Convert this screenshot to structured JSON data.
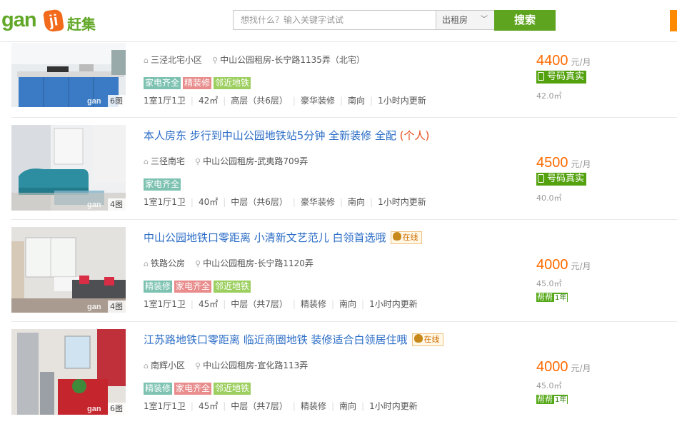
{
  "header": {
    "logo_text": "gan",
    "logo_badge": "ji",
    "logo_cn": "赶集",
    "search_placeholder": "想找什么？输入关键字试试",
    "category": "出租房",
    "search_button": "搜索"
  },
  "listings": [
    {
      "title": "",
      "personal": "",
      "online": "",
      "community": "三泾北宅小区",
      "location": "中山公园租房-长宁路1135弄（北宅）",
      "tags": [
        "家电齐全",
        "精装修",
        "邻近地铁"
      ],
      "meta": [
        "1室1厅1卫",
        "42㎡",
        "高层（共6层）",
        "豪华装修",
        "南向",
        "1小时内更新"
      ],
      "price": "4400",
      "price_unit": "元/月",
      "verify": "号码真实",
      "area": "42.0㎡",
      "bangbang": "",
      "photo_count": "6图"
    },
    {
      "title": "本人房东 步行到中山公园地铁站5分钟 全新装修 全配",
      "personal": "(个人)",
      "online": "",
      "community": "三径南宅",
      "location": "中山公园租房-武夷路709弄",
      "tags": [
        "家电齐全"
      ],
      "meta": [
        "1室1厅1卫",
        "40㎡",
        "中层（共6层）",
        "豪华装修",
        "南向",
        "1小时内更新"
      ],
      "price": "4500",
      "price_unit": "元/月",
      "verify": "号码真实",
      "area": "40.0㎡",
      "bangbang": "",
      "photo_count": "4图"
    },
    {
      "title": "中山公园地铁口零距离 小清新文艺范儿 白领首选哦",
      "personal": "",
      "online": "在线",
      "community": "铁路公房",
      "location": "中山公园租房-长宁路1120弄",
      "tags": [
        "精装修",
        "家电齐全",
        "邻近地铁"
      ],
      "meta": [
        "1室1厅1卫",
        "45㎡",
        "中层（共7层）",
        "精装修",
        "南向",
        "1小时内更新"
      ],
      "price": "4000",
      "price_unit": "元/月",
      "verify": "",
      "area": "45.0㎡",
      "bangbang": "帮帮",
      "bangbang_year": "1年",
      "photo_count": "4图"
    },
    {
      "title": "江苏路地铁口零距离 临近商圈地铁 装修适合白领居住哦",
      "personal": "",
      "online": "在线",
      "community": "南辉小区",
      "location": "中山公园租房-宣化路113弄",
      "tags": [
        "精装修",
        "家电齐全",
        "邻近地铁"
      ],
      "meta": [
        "1室1厅1卫",
        "45㎡",
        "中层（共7层）",
        "精装修",
        "南向",
        "1小时内更新"
      ],
      "price": "4000",
      "price_unit": "元/月",
      "verify": "",
      "area": "45.0㎡",
      "bangbang": "帮帮",
      "bangbang_year": "1年",
      "photo_count": "6图"
    }
  ],
  "watermark": "gan",
  "colors": {
    "brand_green": "#62a828",
    "brand_orange": "#f26a1b",
    "link_blue": "#2a6cc6",
    "price_orange": "#ff6a00"
  }
}
